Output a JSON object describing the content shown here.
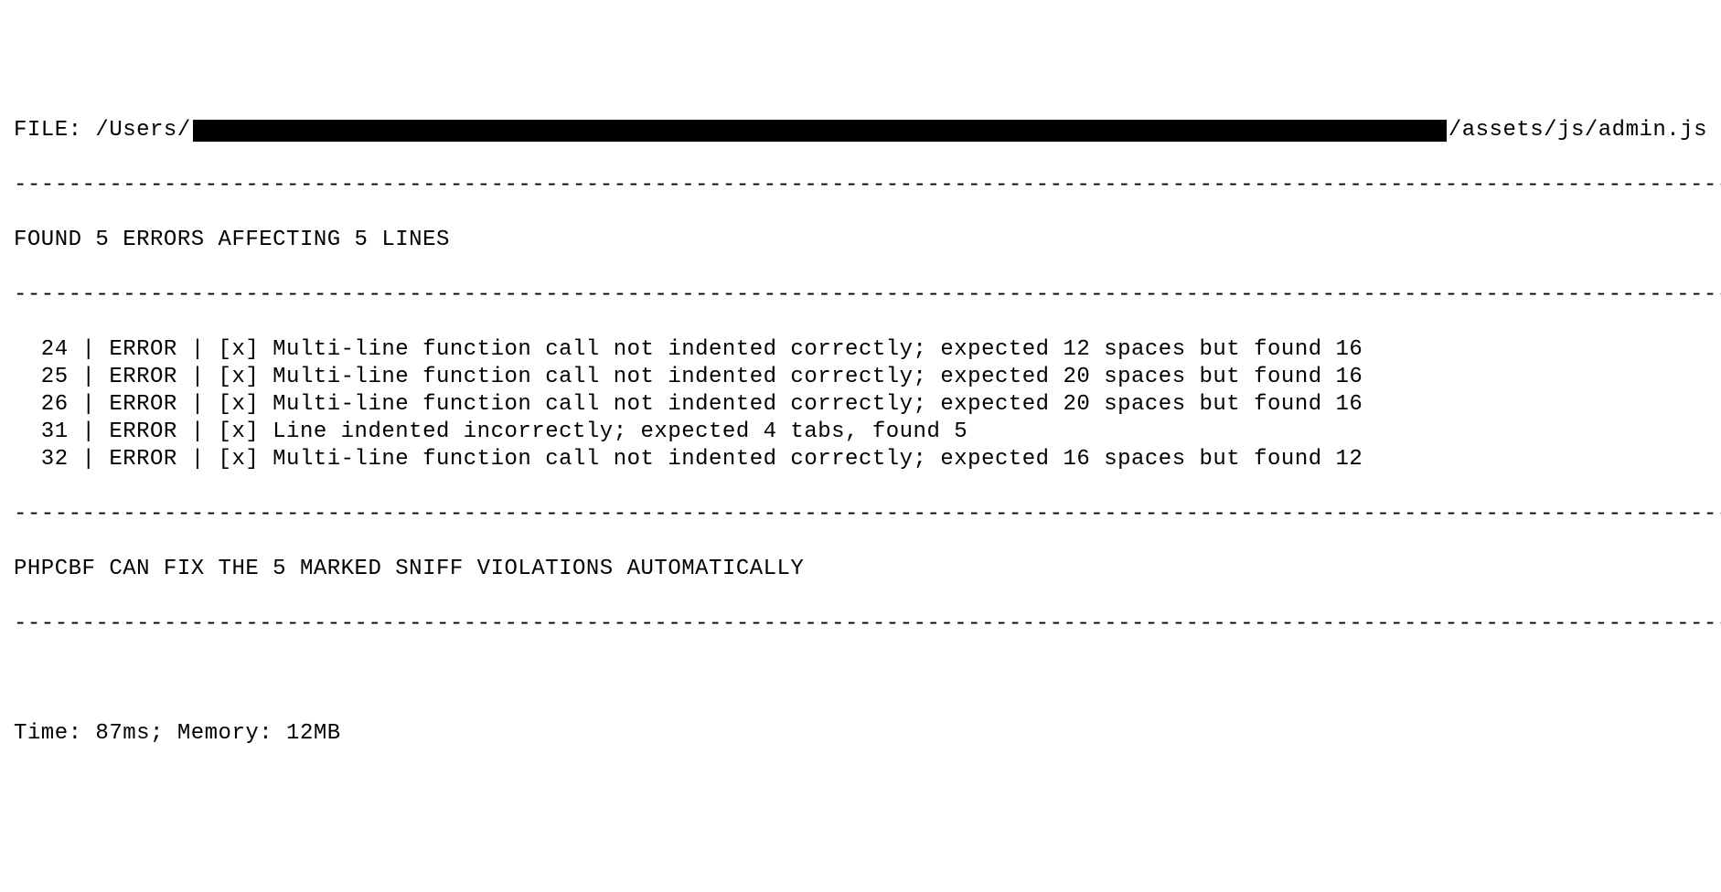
{
  "file_prefix": "FILE: /Users/",
  "file_suffix": "/assets/js/admin.js",
  "divider": "----------------------------------------------------------------------------------------------------------------------------------------------",
  "summary": "FOUND 5 ERRORS AFFECTING 5 LINES",
  "errors": [
    {
      "line": "24",
      "level": "ERROR",
      "marker": "[x]",
      "message": "Multi-line function call not indented correctly; expected 12 spaces but found 16"
    },
    {
      "line": "25",
      "level": "ERROR",
      "marker": "[x]",
      "message": "Multi-line function call not indented correctly; expected 20 spaces but found 16"
    },
    {
      "line": "26",
      "level": "ERROR",
      "marker": "[x]",
      "message": "Multi-line function call not indented correctly; expected 20 spaces but found 16"
    },
    {
      "line": "31",
      "level": "ERROR",
      "marker": "[x]",
      "message": "Line indented incorrectly; expected 4 tabs, found 5"
    },
    {
      "line": "32",
      "level": "ERROR",
      "marker": "[x]",
      "message": "Multi-line function call not indented correctly; expected 16 spaces but found 12"
    }
  ],
  "fix_message": "PHPCBF CAN FIX THE 5 MARKED SNIFF VIOLATIONS AUTOMATICALLY",
  "timing": "Time: 87ms; Memory: 12MB"
}
